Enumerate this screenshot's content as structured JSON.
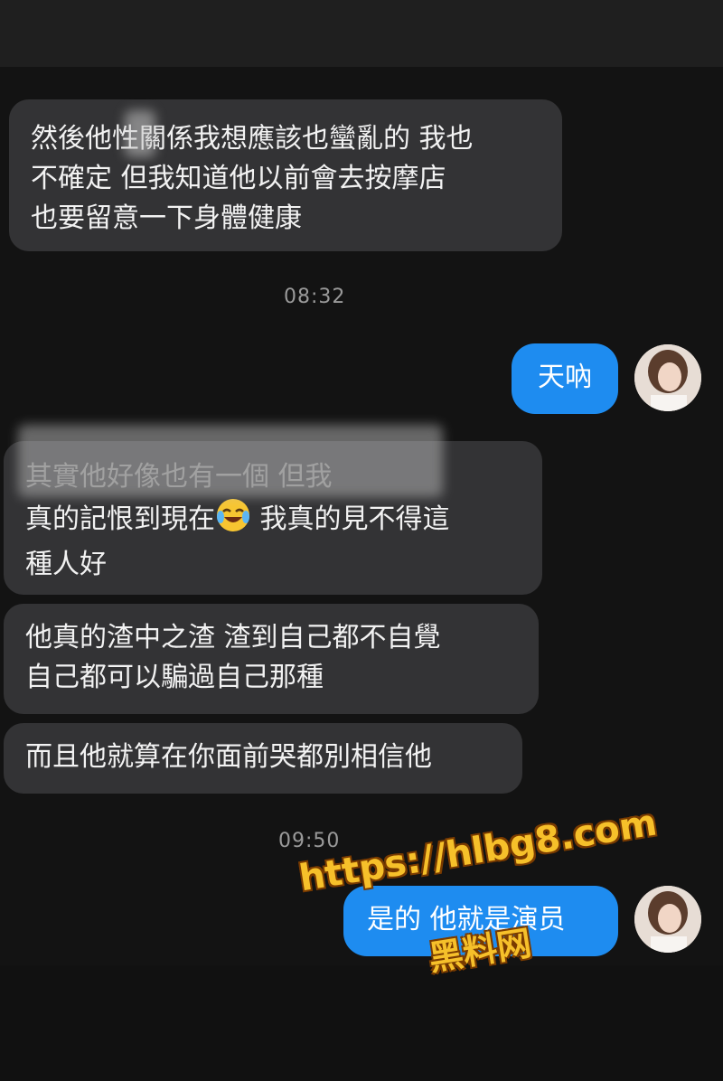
{
  "messages": [
    {
      "text": "然後他性關係我想應該也蠻亂的 我也\n不確定 但我知道他以前會去按摩店\n也要留意一下身體健康"
    },
    {
      "time": "08:32"
    },
    {
      "text": "天吶"
    },
    {
      "text_line1": "其實他好像也有一個 但我",
      "text_line2a": "真的記恨到現在",
      "text_line2b": " 我真的見不得這",
      "text_line3": "種人好"
    },
    {
      "text": "他真的渣中之渣 渣到自己都不自覺\n自己都可以騙過自己那種"
    },
    {
      "text": "而且他就算在你面前哭都別相信他"
    },
    {
      "time": "09:50"
    },
    {
      "text": "是的 他就是演员"
    }
  ],
  "icons": {
    "emoji": "joy-emoji",
    "avatar": "avatar"
  },
  "watermark": {
    "url": "https://hlbg8.com",
    "name": "黑料网"
  },
  "colors": {
    "background": "#131313",
    "incoming_bubble": "#333335",
    "outgoing_bubble": "#1e8cf0"
  }
}
